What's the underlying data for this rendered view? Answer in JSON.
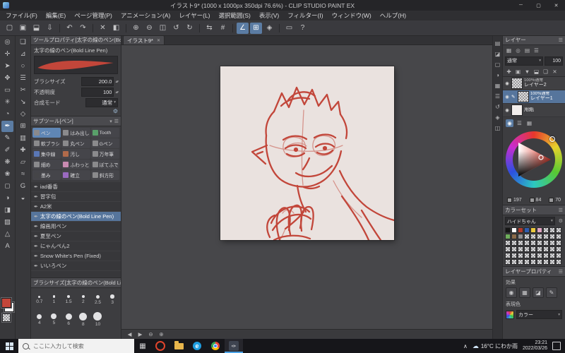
{
  "colors": {
    "accent_blue": "#56759c",
    "active_blue": "#6f97c4",
    "stroke_red": "#c2463a",
    "canvas_bg": "#eae2df",
    "panel_bg": "#3d3d40",
    "taskbar_bg": "#16161a"
  },
  "ui": {
    "collapse_icon": "▾",
    "menu_icon": "☰",
    "caret": "▾",
    "stepper": "▴▾",
    "eye": "◉",
    "edit": "✎",
    "pen_item": "✒",
    "wrench": "⚙",
    "minimize": "─",
    "maximize": "▢",
    "close": "✕",
    "task_view_icon": "▦",
    "tray_expand": "∧",
    "weather_icon": "☁"
  },
  "titlebar": {
    "title": "イラスト9* (1000 x 1000px 350dpi 76.6%) - CLIP STUDIO PAINT EX"
  },
  "menubar": {
    "items": [
      "ファイル(F)",
      "編集(E)",
      "ページ管理(P)",
      "アニメーション(A)",
      "レイヤー(L)",
      "選択範囲(S)",
      "表示(V)",
      "フィルター(I)",
      "ウィンドウ(W)",
      "ヘルプ(H)"
    ]
  },
  "toolbar": {
    "icons": [
      {
        "name": "new-canvas-icon",
        "glyph": "▢"
      },
      {
        "name": "open-file-icon",
        "glyph": "▣"
      },
      {
        "name": "save-icon",
        "glyph": "⬓"
      },
      {
        "name": "export-icon",
        "glyph": "⇩"
      },
      {
        "sep": true
      },
      {
        "name": "undo-icon",
        "glyph": "↶"
      },
      {
        "name": "redo-icon",
        "glyph": "↷"
      },
      {
        "sep": true
      },
      {
        "name": "clear-icon",
        "glyph": "✕"
      },
      {
        "name": "fill-icon",
        "glyph": "◧"
      },
      {
        "sep": true
      },
      {
        "name": "zoom-in-icon",
        "glyph": "⊕"
      },
      {
        "name": "zoom-out-icon",
        "glyph": "⊖"
      },
      {
        "name": "fit-screen-icon",
        "glyph": "◫"
      },
      {
        "name": "rotate-left-icon",
        "glyph": "↺"
      },
      {
        "name": "rotate-right-icon",
        "glyph": "↻"
      },
      {
        "sep": true
      },
      {
        "name": "flip-horizontal-icon",
        "glyph": "⇆"
      },
      {
        "name": "grid-icon",
        "glyph": "#"
      },
      {
        "sep": true
      },
      {
        "name": "snap-ruler-icon",
        "glyph": "∠",
        "active": true
      },
      {
        "name": "snap-grid-icon",
        "glyph": "⊞",
        "active": true
      },
      {
        "name": "snap-special-ruler-icon",
        "glyph": "◈"
      },
      {
        "sep": true
      },
      {
        "name": "ruler-icon",
        "glyph": "▭"
      },
      {
        "name": "help-icon",
        "glyph": "?"
      }
    ]
  },
  "tools_primary": [
    {
      "name": "magnifier-tool-icon",
      "glyph": "◎"
    },
    {
      "name": "move-tool-icon",
      "glyph": "✛"
    },
    {
      "name": "object-tool-icon",
      "glyph": "➤"
    },
    {
      "name": "layer-move-tool-icon",
      "glyph": "✥"
    },
    {
      "name": "selection-tool-icon",
      "glyph": "▭"
    },
    {
      "name": "auto-select-tool-icon",
      "glyph": "✳"
    },
    {
      "name": "eyedropper-tool-icon",
      "glyph": "◔"
    },
    {
      "name": "pen-tool-icon",
      "glyph": "✒",
      "active": true
    },
    {
      "name": "pencil-tool-icon",
      "glyph": "✎"
    },
    {
      "name": "brush-tool-icon",
      "glyph": "✐"
    },
    {
      "name": "airbrush-tool-icon",
      "glyph": "❋"
    },
    {
      "name": "decoration-tool-icon",
      "glyph": "❀"
    },
    {
      "name": "eraser-tool-icon",
      "glyph": "◻"
    },
    {
      "name": "blend-tool-icon",
      "glyph": "◑"
    },
    {
      "name": "fill-tool-icon",
      "glyph": "◨"
    },
    {
      "name": "gradient-tool-icon",
      "glyph": "▨"
    },
    {
      "name": "figure-tool-icon",
      "glyph": "△"
    },
    {
      "name": "text-tool-icon",
      "glyph": "A"
    }
  ],
  "tools_secondary": [
    {
      "name": "frame-border-tool-icon",
      "glyph": "❏"
    },
    {
      "name": "ruler-tool-icon",
      "glyph": "⊿"
    },
    {
      "name": "balloon-tool-icon",
      "glyph": "○"
    },
    {
      "name": "stream-line-tool-icon",
      "glyph": "☰"
    },
    {
      "name": "scissors-tool-icon",
      "glyph": "✂"
    },
    {
      "name": "line-correct-tool-icon",
      "glyph": "↘"
    },
    {
      "name": "figure-sub-tool-icon",
      "glyph": "◇"
    },
    {
      "name": "grid-sub-tool-icon",
      "glyph": "⊞"
    },
    {
      "name": "tone-tool-icon",
      "glyph": "▥"
    },
    {
      "name": "add-sub-tool-icon",
      "glyph": "✚"
    },
    {
      "name": "perspective-tool-icon",
      "glyph": "▱"
    },
    {
      "name": "wave-tool-icon",
      "glyph": "≈"
    },
    {
      "name": "g-pen-shortcut-icon",
      "glyph": "G"
    },
    {
      "name": "contrast-tool-icon",
      "glyph": "◒"
    }
  ],
  "tool_property": {
    "header": "ツールプロパティ[太字の線のペン(Bold...",
    "brush_name": "太字の線のペン(Bold Line Pen)",
    "params": [
      {
        "label": "ブラシサイズ",
        "value": "200.0"
      },
      {
        "label": "不透明度",
        "value": "100"
      },
      {
        "label": "合成モード",
        "value": "通常"
      }
    ]
  },
  "subtool": {
    "header": "サブツール[ペン]",
    "grid": [
      {
        "label": "ペン",
        "color": "#8a8a8c",
        "active": true
      },
      {
        "label": "はみ出し",
        "color": "#8a8a8c"
      },
      {
        "label": "Tooth",
        "color": "#59a06a"
      },
      {
        "label": "軟ブラシ",
        "color": "#8a8a8c"
      },
      {
        "label": "丸ペン",
        "color": "#8a8a8c"
      },
      {
        "label": "Gペン",
        "color": "#8a8a8c"
      },
      {
        "label": "集中線",
        "color": "#5a77b5"
      },
      {
        "label": "汚し",
        "color": "#b06a4a"
      },
      {
        "label": "万年筆",
        "color": "#8a8a8c"
      },
      {
        "label": "細め",
        "color": "#8a8a8c"
      },
      {
        "label": "ふわっと",
        "color": "#c88ab0"
      },
      {
        "label": "ぼてふで",
        "color": "#8a8a8c"
      },
      {
        "label": "墨み",
        "color": "#454548"
      },
      {
        "label": "確立",
        "color": "#9a6ac0"
      },
      {
        "label": "斜方形",
        "color": "#8a8a8c"
      }
    ],
    "list": [
      {
        "label": "iad番香"
      },
      {
        "label": "習字包"
      },
      {
        "label": "A2米"
      },
      {
        "label": "太字の線のペン(Bold Line Pen)",
        "selected": true
      },
      {
        "label": "線画用ペン"
      },
      {
        "label": "夏至ペン"
      },
      {
        "label": "にゃんぺん2"
      },
      {
        "label": "Snow White's Pen (Fixed)"
      },
      {
        "label": "いいろペン"
      }
    ]
  },
  "brush_size_panel": {
    "header": "ブラシサイズ[太字の線のペン(Bold Lin...",
    "sizes": [
      {
        "value": "0.7",
        "dot": 3
      },
      {
        "value": "1",
        "dot": 3.5
      },
      {
        "value": "1.5",
        "dot": 4
      },
      {
        "value": "2",
        "dot": 4.5
      },
      {
        "value": "2.5",
        "dot": 5
      },
      {
        "value": "3",
        "dot": 5.5
      },
      {
        "value": "4",
        "dot": 7
      },
      {
        "value": "5",
        "dot": 8
      },
      {
        "value": "6",
        "dot": 9
      },
      {
        "value": "8",
        "dot": 11
      },
      {
        "value": "10",
        "dot": 12
      }
    ]
  },
  "canvas": {
    "tab": "イラスト9*",
    "close": "✕"
  },
  "canvas_status_icons": [
    {
      "name": "nav-prev-icon",
      "glyph": "◀"
    },
    {
      "name": "nav-next-icon",
      "glyph": "▶"
    },
    {
      "name": "zoom-out-status-icon",
      "glyph": "⊖"
    },
    {
      "name": "zoom-in-status-icon",
      "glyph": "⊕"
    }
  ],
  "dock_icons": [
    {
      "name": "dock-layer-icon",
      "glyph": "▤"
    },
    {
      "name": "dock-layer-property-icon",
      "glyph": "◪"
    },
    {
      "name": "dock-navigator-icon",
      "glyph": "▢"
    },
    {
      "name": "dock-color-wheel-icon",
      "glyph": "◑"
    },
    {
      "name": "dock-color-set-icon",
      "glyph": "▦"
    },
    {
      "name": "dock-color-slider-icon",
      "glyph": "☰"
    },
    {
      "name": "dock-history-icon",
      "glyph": "↺"
    },
    {
      "name": "dock-material-icon",
      "glyph": "◈"
    },
    {
      "name": "dock-sub-view-icon",
      "glyph": "◫"
    }
  ],
  "layer_panel": {
    "header": "レイヤー",
    "palette_icons": [
      {
        "name": "layer-filter-icon",
        "glyph": "▦"
      },
      {
        "name": "layer-search-icon",
        "glyph": "◎"
      },
      {
        "name": "layer-thumbnail-size-icon",
        "glyph": "▤"
      },
      {
        "name": "layer-menu-icon",
        "glyph": "☰"
      }
    ],
    "blend_mode": "通常",
    "opacity": "100",
    "command_icons": [
      {
        "name": "new-layer-icon",
        "glyph": "✚"
      },
      {
        "name": "new-folder-icon",
        "glyph": "▣"
      },
      {
        "name": "transfer-layer-icon",
        "glyph": "▼"
      },
      {
        "name": "merge-layer-icon",
        "glyph": "⬓"
      },
      {
        "name": "duplicate-layer-icon",
        "glyph": "❏"
      },
      {
        "name": "delete-layer-icon",
        "glyph": "✕"
      }
    ],
    "layers": [
      {
        "info": "100％通常",
        "name": "レイヤー2",
        "selected": false,
        "thumb": "checker",
        "editing": false
      },
      {
        "info": "100％通常",
        "name": "レイヤー1",
        "selected": true,
        "thumb": "checker",
        "editing": true
      },
      {
        "info": "",
        "name": "用紙",
        "selected": false,
        "thumb": "paper",
        "editing": false
      }
    ]
  },
  "color_tabs": [
    {
      "name": "color-wheel-tab-icon",
      "glyph": "◉",
      "active": true
    },
    {
      "name": "color-slider-tab-icon",
      "glyph": "☰"
    },
    {
      "name": "color-set-tab-icon",
      "glyph": "▦"
    }
  ],
  "color_panel": {
    "rgb": [
      "197",
      "84",
      "70"
    ]
  },
  "color_set": {
    "header": "カラーセット",
    "set_name": "ハイドちゃん",
    "swatches": [
      {
        "color": "#151515"
      },
      {
        "color": "#ffffff"
      },
      {
        "color": "#b23a2c"
      },
      {
        "color": "#2f5cae"
      },
      {
        "color": "#e9c83e"
      },
      {
        "color": "#dfa6c2"
      },
      {
        "checker": true
      },
      {
        "checker": true
      },
      {
        "checker": true
      },
      {
        "color": "#6fae5c"
      },
      {
        "color": "#8a6a4a"
      },
      {
        "color": "#8e8e90"
      },
      {
        "checker": true
      },
      {
        "checker": true
      },
      {
        "checker": true
      },
      {
        "checker": true
      },
      {
        "checker": true
      },
      {
        "checker": true
      },
      {
        "checker": true
      },
      {
        "checker": true
      },
      {
        "checker": true
      },
      {
        "checker": true
      },
      {
        "checker": true
      },
      {
        "checker": true
      },
      {
        "checker": true
      },
      {
        "checker": true
      },
      {
        "checker": true
      },
      {
        "checker": true
      },
      {
        "checker": true
      },
      {
        "checker": true
      },
      {
        "checker": true
      },
      {
        "checker": true
      },
      {
        "checker": true
      },
      {
        "checker": true
      },
      {
        "checker": true
      },
      {
        "checker": true
      },
      {
        "checker": true
      },
      {
        "checker": true
      },
      {
        "checker": true
      },
      {
        "checker": true
      },
      {
        "checker": true
      },
      {
        "checker": true
      },
      {
        "checker": true
      },
      {
        "checker": true
      },
      {
        "checker": true
      },
      {
        "checker": true
      },
      {
        "checker": true
      },
      {
        "checker": true
      },
      {
        "checker": true
      },
      {
        "checker": true
      },
      {
        "checker": true
      },
      {
        "checker": true
      },
      {
        "checker": true
      },
      {
        "checker": true
      }
    ]
  },
  "layer_property": {
    "header": "レイヤープロパティ",
    "effect_label": "効果",
    "effect_icons": [
      {
        "name": "border-effect-icon",
        "glyph": "◉"
      },
      {
        "name": "tone-effect-icon",
        "glyph": "▦"
      },
      {
        "name": "layer-color-icon",
        "glyph": "◪"
      },
      {
        "name": "draft-layer-icon",
        "glyph": "✎"
      }
    ],
    "expression_label": "表現色",
    "expression_value": "カラー"
  },
  "taskbar": {
    "search_placeholder": "ここに入力して検索",
    "weather": "16°C にわか雨",
    "time": "23:21",
    "date": "2022/03/26"
  }
}
